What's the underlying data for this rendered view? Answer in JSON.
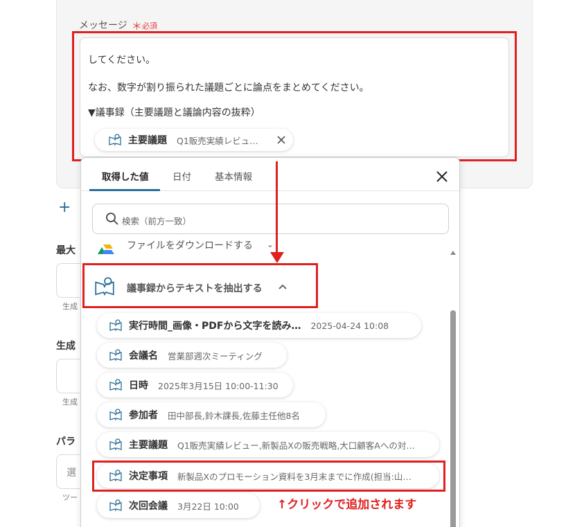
{
  "message_field": {
    "label": "メッセージ",
    "required_star": "＊",
    "required_text": "必須",
    "lines": [
      "してください。",
      "なお、数字が割り振られた議題ごとに論点をまとめてください。",
      "▼議事録（主要議題と議論内容の抜粋）"
    ],
    "inserted_pill": {
      "name": "主要議題",
      "value": "Q1販売実績レビュ…",
      "remove_icon": "close-icon"
    }
  },
  "left_partial": {
    "add_icon": "+",
    "label_1": "最大",
    "small_1": "生成",
    "label_2": "生成",
    "small_2": "生成",
    "label_3": "パラ",
    "select_text": "選",
    "small_3": "ツー"
  },
  "panel": {
    "tabs": [
      {
        "label": "取得した値"
      },
      {
        "label": "日付"
      },
      {
        "label": "基本情報"
      }
    ],
    "close_icon": "close-icon",
    "search_placeholder": "検索（前方一致）",
    "partial_row": "ファイルをダウンロードする",
    "group": {
      "title": "議事録からテキストを抽出する",
      "expanded_icon": "chevron-up-icon"
    },
    "items": [
      {
        "name": "実行時間_画像・PDFから文字を読み…",
        "value": "2025-04-24 10:08"
      },
      {
        "name": "会議名",
        "value": "営業部週次ミーティング"
      },
      {
        "name": "日時",
        "value": "2025年3月15日 10:00-11:30"
      },
      {
        "name": "参加者",
        "value": "田中部長,鈴木課長,佐藤主任他8名"
      },
      {
        "name": "主要議題",
        "value": "Q1販売実績レビュー,新製品Xの販売戦略,大口顧客Aへの対…"
      },
      {
        "name": "決定事項",
        "value": "新製品Xのプロモーション資料を3月末までに作成(担当:山…"
      },
      {
        "name": "次回会議",
        "value": "3月22日 10:00"
      }
    ]
  },
  "annotation": "↑クリックで追加されます",
  "colors": {
    "highlight_red": "#e01f1f",
    "accent": "#2a6f97",
    "required": "#e53e3e"
  }
}
